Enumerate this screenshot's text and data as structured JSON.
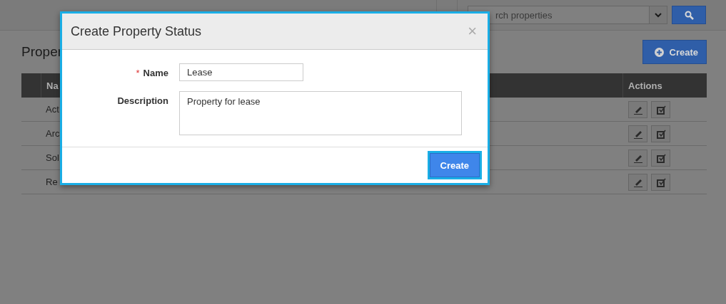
{
  "topbar": {
    "search": {
      "placeholder": "rch properties"
    }
  },
  "page": {
    "title": "Proper",
    "create_button": "Create"
  },
  "table": {
    "columns": [
      "Na",
      "Actions"
    ],
    "rows": [
      {
        "name": "Act"
      },
      {
        "name": "Arc"
      },
      {
        "name": "Sol"
      },
      {
        "name": "Re"
      }
    ]
  },
  "dialog": {
    "title": "Create Property Status",
    "close": "×",
    "fields": [
      {
        "kind": "input",
        "label": "Name",
        "required_mark": "*",
        "value": "Lease"
      },
      {
        "kind": "textarea",
        "label": "Description",
        "value": "Property for lease"
      }
    ],
    "submit": {
      "label": "Create",
      "focused": true
    }
  }
}
